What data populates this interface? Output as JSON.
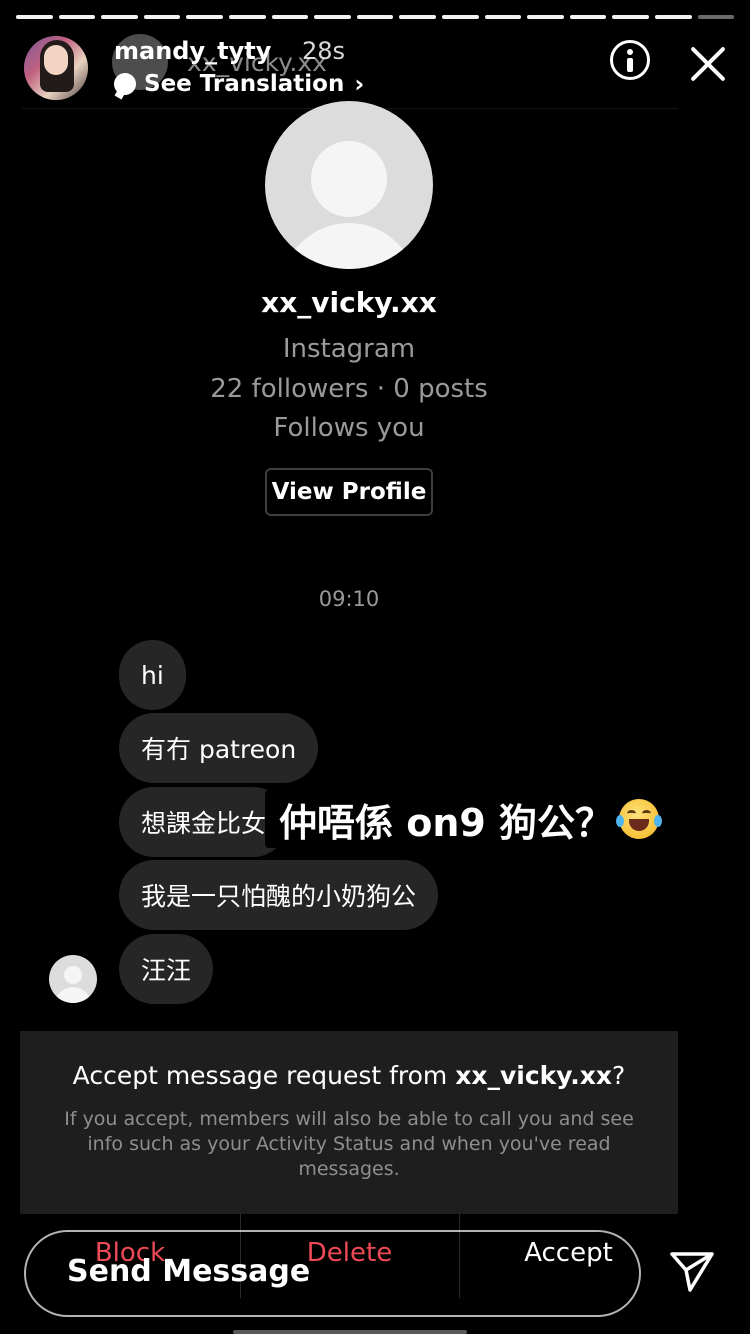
{
  "story": {
    "username": "mandy_tyty",
    "time": "28s",
    "translation_label": "See Translation",
    "ghost_username": "xx_vicky.xx",
    "progress_segments": 17,
    "progress_done": 16
  },
  "profile": {
    "name": "xx_vicky.xx",
    "platform": "Instagram",
    "stats": "22 followers · 0 posts",
    "follows": "Follows you",
    "view_profile_label": "View Profile"
  },
  "chat": {
    "timestamp": "09:10",
    "messages": [
      {
        "text": "hi"
      },
      {
        "text": "有冇 patreon"
      },
      {
        "text": "想課金比女"
      },
      {
        "text": "我是一只怕醜的小奶狗公"
      },
      {
        "text": "汪汪"
      }
    ]
  },
  "sticker": {
    "text": "仲唔係 on9 狗公？"
  },
  "request": {
    "title_prefix": "Accept message request from ",
    "title_user": "xx_vicky.xx",
    "title_suffix": "?",
    "description": "If you accept, members will also be able to call you and see info such as your Activity Status and when you've read messages.",
    "actions": {
      "block": "Block",
      "delete": "Delete",
      "accept": "Accept"
    }
  },
  "reply": {
    "label": "Send Message"
  },
  "colors": {
    "danger": "#ed4956",
    "bubble": "#262626",
    "muted": "#9a9a9a"
  },
  "icons": [
    "info-icon",
    "close-icon",
    "send-icon",
    "translation-icon",
    "chevron-right-icon",
    "laughing-emoji-icon"
  ]
}
